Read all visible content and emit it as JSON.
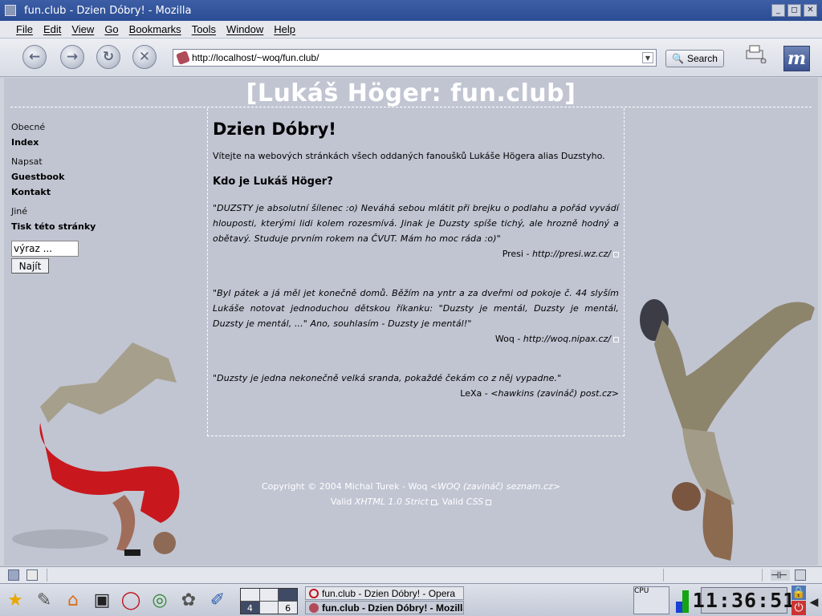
{
  "window": {
    "title": "fun.club - Dzien Dóbry! - Mozilla"
  },
  "menu": [
    "File",
    "Edit",
    "View",
    "Go",
    "Bookmarks",
    "Tools",
    "Window",
    "Help"
  ],
  "toolbar": {
    "url": "http://localhost/~woq/fun.club/",
    "search_label": "Search"
  },
  "page": {
    "site_title": "[Lukáš Höger: fun.club]",
    "nav": {
      "group1_title": "Obecné",
      "group1_links": [
        "Index"
      ],
      "group2_title": "Napsat",
      "group2_links": [
        "Guestbook",
        "Kontakt"
      ],
      "group3_title": "Jiné",
      "group3_links": [
        "Tisk této stránky"
      ],
      "search_value": "výraz ...",
      "search_button": "Najít"
    },
    "heading": "Dzien Dóbry!",
    "intro": "Vítejte na webových stránkách všech oddaných fanoušků Lukáše Högera alias Duzstyho.",
    "subheading": "Kdo je Lukáš Höger?",
    "quotes": [
      {
        "text": "\"DUZSTY je absolutní šílenec :o) Neváhá sebou mlátit při brejku o podlahu a pořád vyvádí hlouposti, kterými lidi kolem rozesmívá. Jinak je Duzsty spíše tichý, ale hrozně hodný a obětavý. Studuje prvním rokem na ČVUT. Mám ho moc ráda :o)\"",
        "author": "Presi - ",
        "url": "http://presi.wz.cz/"
      },
      {
        "text": "\"Byl pátek a já měl jet konečně domů. Běžím na yntr a za dveřmi od pokoje č. 44 slyším Lukáše notovat jednoduchou dětskou říkanku: \"Duzsty je mentál, Duzsty je mentál, Duzsty je mentál, ...\" Ano, souhlasím - Duzsty je mentál!\"",
        "author": "Woq - ",
        "url": "http://woq.nipax.cz/"
      },
      {
        "text": "\"Duzsty je jedna nekonečně velká sranda, pokaždé čekám co z něj vypadne.\"",
        "author": "LeXa - ",
        "url": "<hawkins (zavináč) post.cz>"
      }
    ],
    "footer": {
      "copyright": "Copyright © 2004 Michal Turek - Woq ",
      "email": "<WOQ (zavináč) seznam.cz>",
      "valid_prefix": "Valid ",
      "xhtml": "XHTML 1.0 Strict",
      "valid_mid": ", Valid ",
      "css": "CSS"
    }
  },
  "taskbar": {
    "pager": [
      "",
      "",
      "",
      "4",
      "",
      "6"
    ],
    "tasks": [
      "fun.club - Dzien Dóbry! - Opera",
      "fun.club - Dzien Dóbry! - Mozilla"
    ],
    "cpu_label": "CPU",
    "clock": "11:36:51"
  }
}
